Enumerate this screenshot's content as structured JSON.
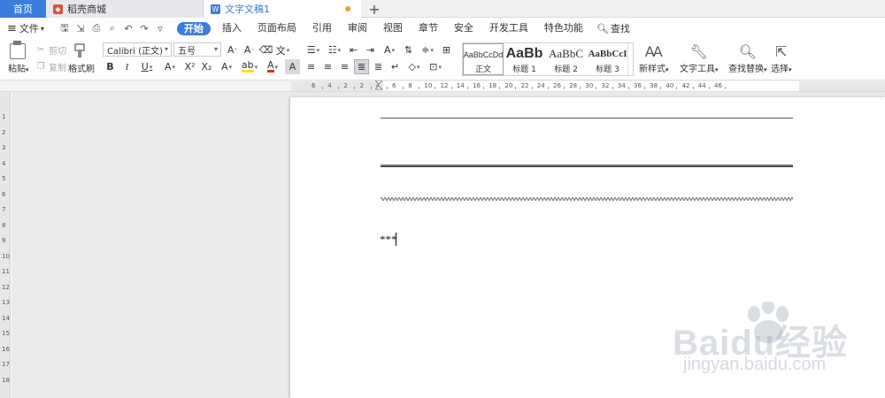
{
  "tabs": {
    "home": "首页",
    "store": "稻壳商城",
    "doc": "文字文稿1",
    "add": "+"
  },
  "menu": {
    "file": "文件",
    "items": [
      "开始",
      "插入",
      "页面布局",
      "引用",
      "审阅",
      "视图",
      "章节",
      "安全",
      "开发工具",
      "特色功能"
    ],
    "search": "查找"
  },
  "ribbon": {
    "paste": "粘贴",
    "cut": "剪切",
    "copy": "复制",
    "format_painter": "格式刷",
    "font_name": "Calibri (正文)",
    "font_size": "五号",
    "styles": [
      {
        "sample": "AaBbCcDd",
        "label": "正文"
      },
      {
        "sample": "AaBb",
        "label": "标题 1"
      },
      {
        "sample": "AaBbC",
        "label": "标题 2"
      },
      {
        "sample": "AaBbCcI",
        "label": "标题 3"
      }
    ],
    "new_style": "新样式",
    "text_tools": "文字工具",
    "find_replace": "查找替换",
    "select": "选择"
  },
  "ruler": {
    "h_ticks": [
      "6",
      "4",
      "2",
      "2",
      "4",
      "6",
      "8",
      "10",
      "12",
      "14",
      "16",
      "18",
      "20",
      "22",
      "24",
      "26",
      "28",
      "30",
      "32",
      "34",
      "36",
      "38",
      "40",
      "42",
      "44",
      "46"
    ],
    "v_ticks": [
      "1",
      "2",
      "3",
      "4",
      "5",
      "6",
      "7",
      "8",
      "9",
      "10",
      "11",
      "12",
      "13",
      "14",
      "15",
      "16",
      "17",
      "18"
    ]
  },
  "document": {
    "typed_text": "***"
  },
  "watermark": {
    "logo": "Baidu经验",
    "url": "jingyan.baidu.com"
  },
  "colors": {
    "accent": "#3b7ddd",
    "tab_bg": "#f0f1f2",
    "canvas_bg": "#e9eaec"
  }
}
